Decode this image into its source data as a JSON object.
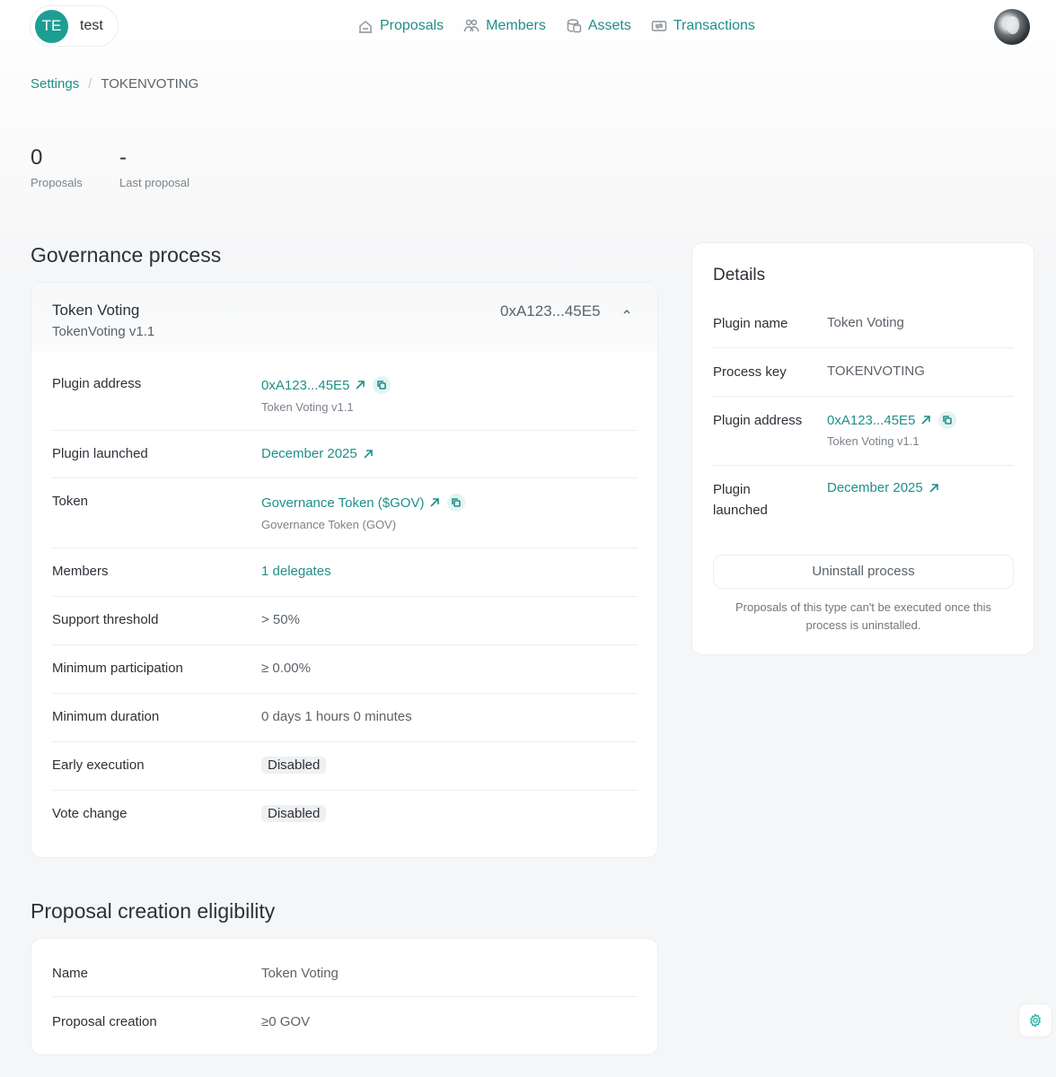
{
  "dao": {
    "initials": "TE",
    "name": "test"
  },
  "nav": [
    {
      "label": "Proposals",
      "icon": "proposals-icon"
    },
    {
      "label": "Members",
      "icon": "members-icon"
    },
    {
      "label": "Assets",
      "icon": "assets-icon"
    },
    {
      "label": "Transactions",
      "icon": "transactions-icon"
    }
  ],
  "breadcrumb": {
    "parent": "Settings",
    "separator": "/",
    "current": "TOKENVOTING"
  },
  "stats": [
    {
      "value": "0",
      "label": "Proposals"
    },
    {
      "value": "-",
      "label": "Last proposal"
    }
  ],
  "governance": {
    "section_title": "Governance process",
    "plugin_name": "Token Voting",
    "plugin_version": "TokenVoting v1.1",
    "plugin_address_short": "0xA123...45E5",
    "rows": {
      "plugin_address": {
        "label": "Plugin address",
        "value": "0xA123...45E5",
        "sub": "Token Voting v1.1"
      },
      "plugin_launched": {
        "label": "Plugin launched",
        "value": "December 2025"
      },
      "token": {
        "label": "Token",
        "value": "Governance Token ($GOV)",
        "sub": "Governance Token (GOV)"
      },
      "members": {
        "label": "Members",
        "value": "1 delegates"
      },
      "support_threshold": {
        "label": "Support threshold",
        "value": "> 50%"
      },
      "minimum_participation": {
        "label": "Minimum participation",
        "value": "≥ 0.00%"
      },
      "minimum_duration": {
        "label": "Minimum duration",
        "value": "0 days 1 hours 0 minutes"
      },
      "early_execution": {
        "label": "Early execution",
        "value": "Disabled"
      },
      "vote_change": {
        "label": "Vote change",
        "value": "Disabled"
      }
    }
  },
  "details": {
    "title": "Details",
    "plugin_name": {
      "label": "Plugin name",
      "value": "Token Voting"
    },
    "process_key": {
      "label": "Process key",
      "value": "TOKENVOTING"
    },
    "plugin_address": {
      "label": "Plugin address",
      "value": "0xA123...45E5",
      "sub": "Token Voting v1.1"
    },
    "plugin_launched": {
      "label": "Plugin launched",
      "value": "December 2025"
    },
    "uninstall_label": "Uninstall process",
    "uninstall_note": "Proposals of this type can't be executed once this process is uninstalled."
  },
  "eligibility": {
    "section_title": "Proposal creation eligibility",
    "name": {
      "label": "Name",
      "value": "Token Voting"
    },
    "proposal_creation": {
      "label": "Proposal creation",
      "value": "≥0 GOV"
    }
  },
  "colors": {
    "accent": "#1f8f88",
    "avatar": "#1d9e94",
    "text": "#2c3138",
    "muted": "#5b636a"
  }
}
